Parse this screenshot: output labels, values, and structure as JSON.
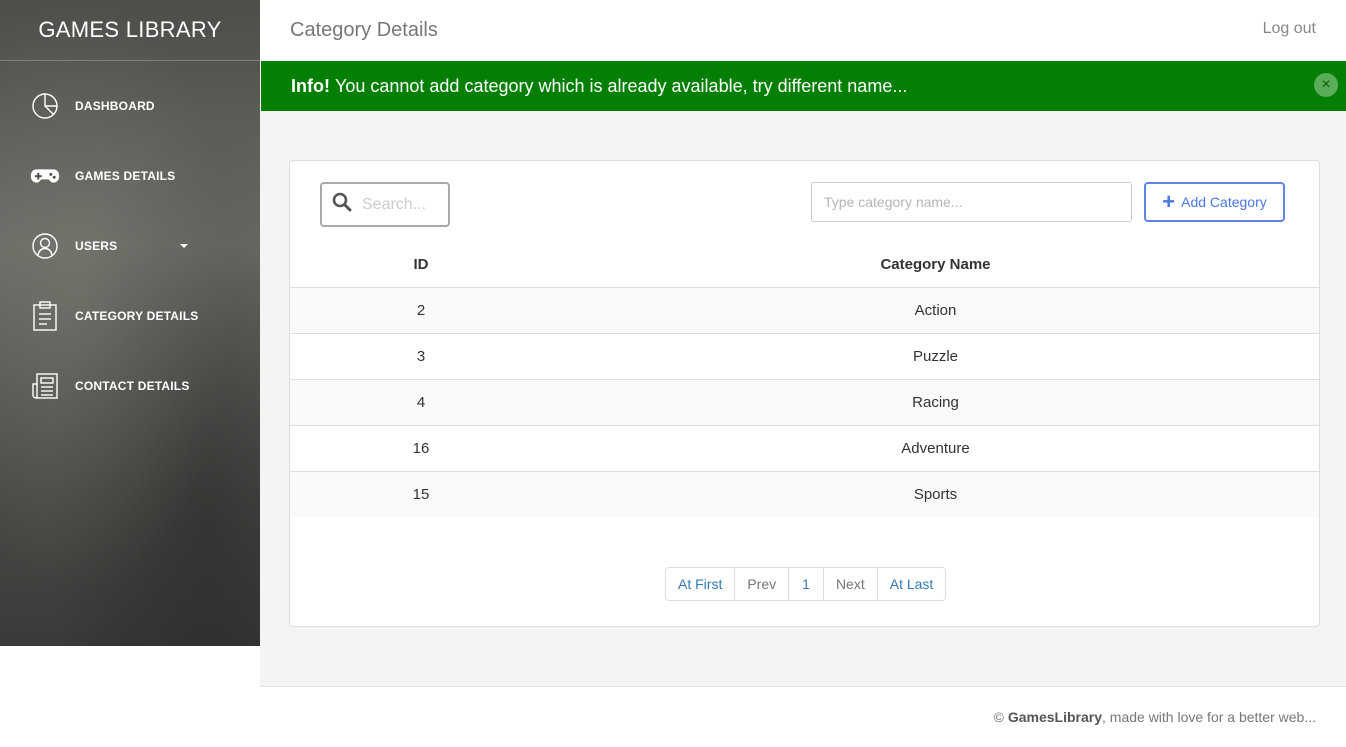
{
  "sidebar": {
    "brand": "GAMES LIBRARY",
    "items": [
      {
        "label": "DASHBOARD",
        "icon": "pie-chart-icon"
      },
      {
        "label": "GAMES DETAILS",
        "icon": "gamepad-icon"
      },
      {
        "label": "USERS",
        "icon": "user-icon",
        "has_caret": true
      },
      {
        "label": "CATEGORY DETAILS",
        "icon": "clipboard-icon"
      },
      {
        "label": "CONTACT DETAILS",
        "icon": "newspaper-icon"
      }
    ]
  },
  "header": {
    "title": "Category Details",
    "logout_label": "Log out"
  },
  "alert": {
    "strong": "Info!",
    "message": "You cannot add category which is already available, try different name...",
    "close_glyph": "×",
    "color": "#038004"
  },
  "toolbar": {
    "search_placeholder": "Search...",
    "category_placeholder": "Type category name...",
    "add_label": "Add Category"
  },
  "table": {
    "headers": [
      "ID",
      "Category Name"
    ],
    "rows": [
      [
        "2",
        "Action"
      ],
      [
        "3",
        "Puzzle"
      ],
      [
        "4",
        "Racing"
      ],
      [
        "16",
        "Adventure"
      ],
      [
        "15",
        "Sports"
      ]
    ]
  },
  "pagination": {
    "first": "At First",
    "prev": "Prev",
    "page": "1",
    "next": "Next",
    "last": "At Last"
  },
  "footer": {
    "copyright": "©",
    "brand": "GamesLibrary",
    "tagline": ", made with love for a better web..."
  }
}
